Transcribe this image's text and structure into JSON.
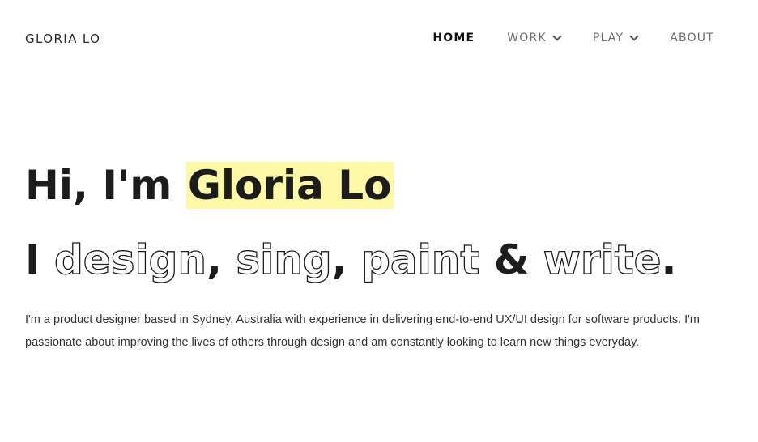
{
  "header": {
    "logo": "GLORIA LO"
  },
  "nav": {
    "items": [
      {
        "label": "HOME",
        "active": true,
        "has_dropdown": false
      },
      {
        "label": "WORK",
        "active": false,
        "has_dropdown": true
      },
      {
        "label": "PLAY",
        "active": false,
        "has_dropdown": true
      },
      {
        "label": "ABOUT",
        "active": false,
        "has_dropdown": false
      }
    ]
  },
  "hero": {
    "greeting_prefix": "Hi, I'm ",
    "name": "Gloria Lo",
    "line2_prefix": "I ",
    "word1": "design",
    "sep1": ", ",
    "word2": "sing",
    "sep2": ", ",
    "word3": "paint",
    "amp": " & ",
    "word4": "write",
    "period": "."
  },
  "bio": {
    "text": "I'm a product designer based in Sydney, Australia with experience in delivering end-to-end UX/UI design for software products. I'm passionate about improving the lives of others through design and am constantly looking to learn new things everyday."
  },
  "colors": {
    "highlight": "#fef9a7",
    "text": "#1c1c1c",
    "nav_inactive": "#6b6b6b"
  }
}
